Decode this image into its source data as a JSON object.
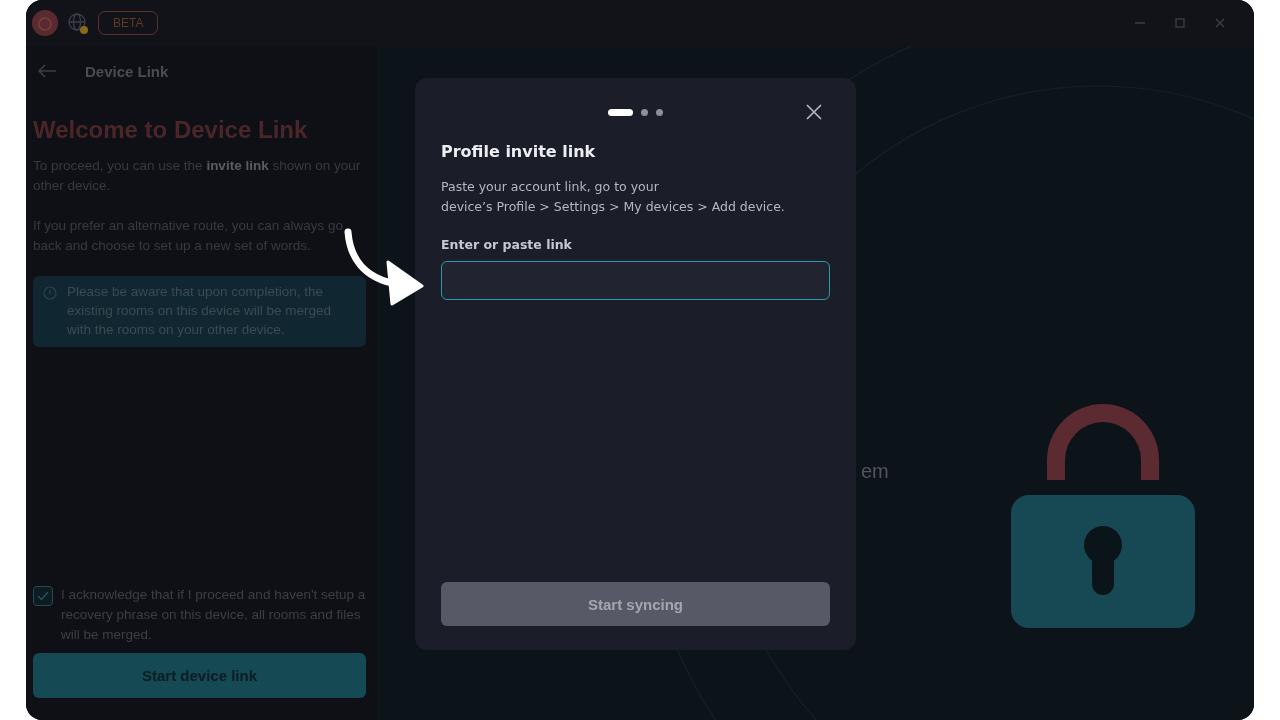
{
  "title_bar": {
    "badge": "BETA"
  },
  "left_panel": {
    "header": "Device Link",
    "title": "Welcome to Device Link",
    "intro": "To proceed, you can use the **invite link** shown on your other device.",
    "alternative": "If you prefer an alternative route, you can always go back and choose to set up a new set of words.",
    "notice": "Please be aware that upon completion, the existing rooms on this device will be merged with the rooms on your other device.",
    "acknowledge": {
      "label": "I acknowledge that if I proceed and haven't setup a recovery phrase on this device, all rooms and files will be merged.",
      "checked": true
    },
    "button": "Start device link"
  },
  "background_text": "em",
  "dialog": {
    "steps": [
      {
        "selected": true
      },
      {
        "selected": false
      },
      {
        "selected": false
      }
    ],
    "title": "Profile invite link",
    "description": "Paste your account link, go to your\ndevice’s Profile > Settings > My devices > Add device.",
    "field_label": "Enter or paste link",
    "button": {
      "label": "Start syncing",
      "disabled": true
    }
  }
}
